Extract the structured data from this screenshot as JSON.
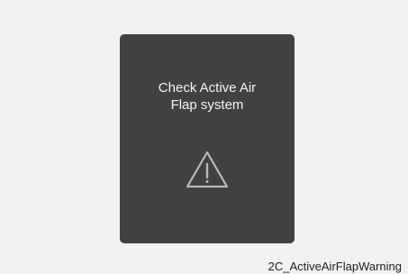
{
  "warning_panel": {
    "message_line1": "Check Active Air",
    "message_line2": "Flap system",
    "icon": "warning-triangle-icon"
  },
  "caption": "2C_ActiveAirFlapWarning",
  "colors": {
    "background": "#f2f2f2",
    "panel": "#414141",
    "text": "#f4f4f4",
    "icon_stroke": "#b9b9b9"
  }
}
